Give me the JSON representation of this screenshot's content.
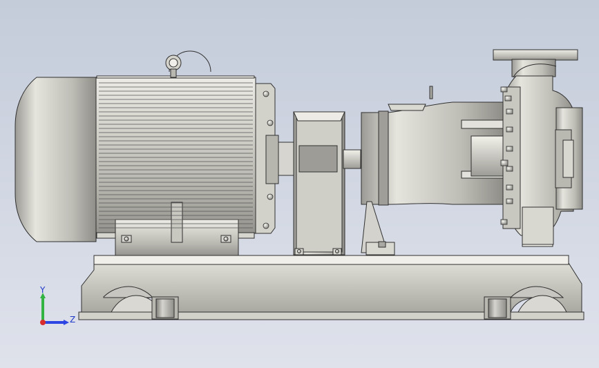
{
  "triad": {
    "y_label": "Y",
    "z_label": "Z"
  },
  "colors": {
    "background_top": "#c8cfdb",
    "background_bottom": "#d9dde8",
    "metal_light": "#d7d6cf",
    "metal_mid": "#b7b6af",
    "metal_dark": "#8f8e88",
    "outline": "#2f2f2f",
    "axis_y": "#33b442",
    "axis_z": "#2d45e3",
    "axis_x": "#d92d2d"
  }
}
